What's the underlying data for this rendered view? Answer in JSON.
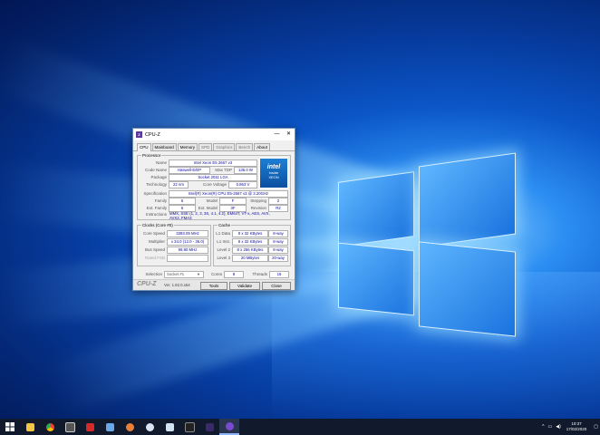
{
  "window": {
    "title": "CPU-Z",
    "app_icon": "cpuz-icon",
    "controls": {
      "minimize": "—",
      "maximize": "☐",
      "close": "✕"
    }
  },
  "tabs": [
    {
      "label": "CPU",
      "active": true
    },
    {
      "label": "Mainboard",
      "active": false
    },
    {
      "label": "Memory",
      "active": false
    },
    {
      "label": "SPD",
      "active": false
    },
    {
      "label": "Graphics",
      "active": false
    },
    {
      "label": "Bench",
      "active": false
    },
    {
      "label": "About",
      "active": false
    }
  ],
  "processor": {
    "legend": "Processor",
    "name_label": "Name",
    "name": "Intel Xeon E5 2667 v3",
    "codename_label": "Code Name",
    "codename": "Haswell-E/EP",
    "maxtdp_label": "Max TDP",
    "maxtdp": "135.0 W",
    "package_label": "Package",
    "package": "Socket 2011 LGA",
    "technology_label": "Technology",
    "technology": "22 nm",
    "corevoltage_label": "Core Voltage",
    "corevoltage": "0.863 V",
    "logo_brand": "intel",
    "logo_sub1": "inside",
    "logo_sub2": "XEON",
    "spec_label": "Specification",
    "spec": "Intel(R) Xeon(R) CPU E5-2667 v3 @ 3.20GHz",
    "family_label": "Family",
    "family": "6",
    "model_label": "Model",
    "model": "F",
    "stepping_label": "Stepping",
    "stepping": "2",
    "extfamily_label": "Ext. Family",
    "extfamily": "6",
    "extmodel_label": "Ext. Model",
    "extmodel": "3F",
    "revision_label": "Revision",
    "revision": "R2",
    "instructions_label": "Instructions",
    "instructions_line1": "MMX, SSE (1, 2, 3, 3S, 4.1, 4.2), EM64T, VT-x, AES, AVX,",
    "instructions_line2": "AVX2, FMA3"
  },
  "clocks": {
    "legend": "Clocks (Core #0)",
    "corespeed_label": "Core Speed",
    "corespeed": "3393.09 MHz",
    "multiplier_label": "Multiplier",
    "multiplier": "x 34.0 (12.0 - 36.0)",
    "busspeed_label": "Bus Speed",
    "busspeed": "99.80 MHz",
    "ratedfsb_label": "Rated FSB",
    "ratedfsb": ""
  },
  "cache": {
    "legend": "Cache",
    "l1d_label": "L1 Data",
    "l1d": "8 x 32 KBytes",
    "l1d_way": "8-way",
    "l1i_label": "L1 Inst.",
    "l1i": "8 x 32 KBytes",
    "l1i_way": "8-way",
    "l2_label": "Level 2",
    "l2": "8 x 256 KBytes",
    "l2_way": "8-way",
    "l3_label": "Level 3",
    "l3": "20 MBytes",
    "l3_way": "20-way"
  },
  "selection": {
    "label": "Selection",
    "value": "Socket #1",
    "cores_label": "Cores",
    "cores": "8",
    "threads_label": "Threads",
    "threads": "16"
  },
  "footer": {
    "logo": "CPU-Z",
    "version": "Ver. 1.92.0.x64",
    "tools": "Tools",
    "validate": "Validate",
    "close": "Close"
  },
  "taskbar": {
    "icons": [
      "windows-start-icon",
      "chrome-icon",
      "calculator-icon",
      "red-app-icon",
      "network-icon",
      "paint-icon",
      "cloud-icon",
      "notepad-icon",
      "terminal-icon",
      "purple-app-icon",
      "cpuz-taskbar-icon"
    ],
    "tray_chevron": "^",
    "time": "10:37",
    "date": "17/02/2020"
  }
}
